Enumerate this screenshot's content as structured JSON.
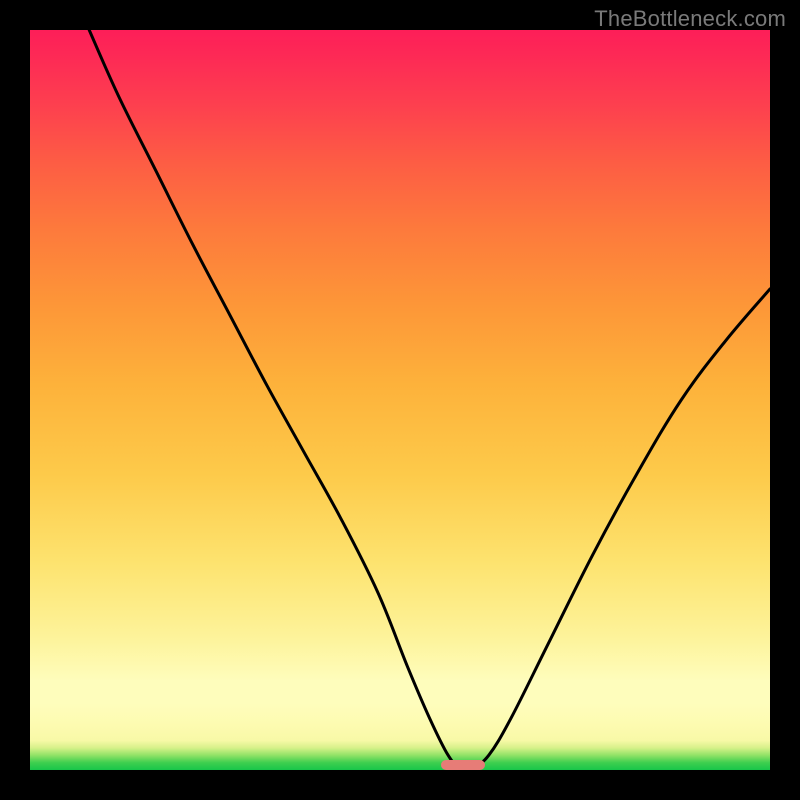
{
  "watermark": "TheBottleneck.com",
  "chart_data": {
    "type": "line",
    "title": "",
    "xlabel": "",
    "ylabel": "",
    "xlim": [
      0,
      100
    ],
    "ylim": [
      0,
      100
    ],
    "grid": false,
    "legend": false,
    "background": {
      "type": "vertical-gradient",
      "stops": [
        {
          "pos": 0,
          "color": "#18c64a"
        },
        {
          "pos": 2,
          "color": "#91e267"
        },
        {
          "pos": 5,
          "color": "#f8f9a7"
        },
        {
          "pos": 12,
          "color": "#fefdbc"
        },
        {
          "pos": 28,
          "color": "#fde36f"
        },
        {
          "pos": 52,
          "color": "#fdb23b"
        },
        {
          "pos": 73,
          "color": "#fd7a3c"
        },
        {
          "pos": 90,
          "color": "#fd3f4f"
        },
        {
          "pos": 100,
          "color": "#fd1e58"
        }
      ]
    },
    "series": [
      {
        "name": "bottleneck-curve",
        "x": [
          8,
          12,
          17,
          22,
          27,
          32,
          37,
          42,
          47,
          51,
          54,
          56.5,
          58,
          60,
          62,
          65,
          70,
          76,
          82,
          88,
          94,
          100
        ],
        "values": [
          100,
          91,
          81,
          71,
          61.5,
          52,
          43,
          34,
          24,
          14,
          7,
          2,
          0.5,
          0.5,
          2,
          7,
          17,
          29,
          40,
          50,
          58,
          65
        ]
      }
    ],
    "marker": {
      "name": "optimal-range",
      "x_start": 55.5,
      "x_end": 61.5,
      "y": 0,
      "color": "#e77c77"
    }
  },
  "layout": {
    "frame_size": 800,
    "plot_inset": 30,
    "plot_size": 740
  }
}
